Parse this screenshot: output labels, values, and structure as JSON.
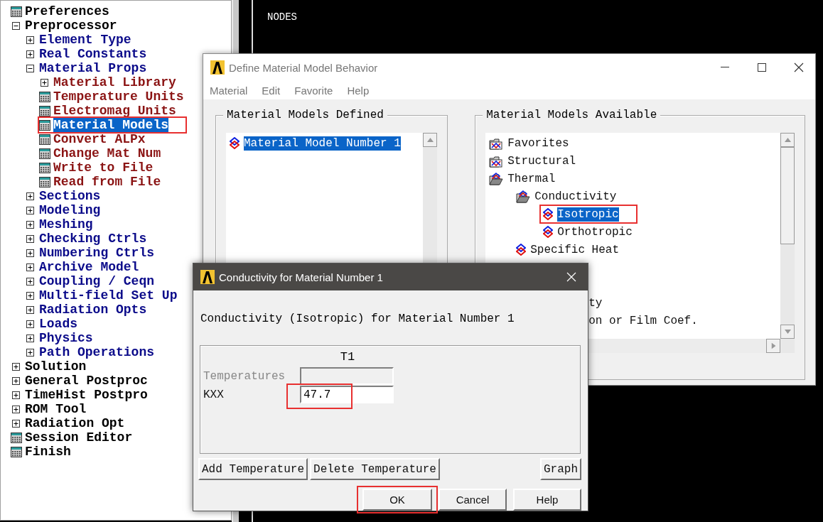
{
  "sidebar": {
    "items": [
      {
        "label": "Preferences",
        "kind": "action",
        "selected": false
      },
      {
        "label": "Preprocessor",
        "kind": "branch",
        "expanded": true,
        "selected": false,
        "children": [
          {
            "label": "Element Type",
            "kind": "branch",
            "expanded": false,
            "selected": false
          },
          {
            "label": "Real Constants",
            "kind": "branch",
            "expanded": false,
            "selected": false
          },
          {
            "label": "Material Props",
            "kind": "branch",
            "expanded": true,
            "selected": false,
            "children": [
              {
                "label": "Material Library",
                "kind": "branch",
                "expanded": false,
                "selected": false
              },
              {
                "label": "Temperature Units",
                "kind": "action",
                "selected": false
              },
              {
                "label": "Electromag Units",
                "kind": "action",
                "selected": false
              },
              {
                "label": "Material Models",
                "kind": "action",
                "selected": true,
                "annotated": true
              },
              {
                "label": "Convert ALPx",
                "kind": "action",
                "selected": false
              },
              {
                "label": "Change Mat Num",
                "kind": "action",
                "selected": false
              },
              {
                "label": "Write to File",
                "kind": "action",
                "selected": false
              },
              {
                "label": "Read from File",
                "kind": "action",
                "selected": false
              }
            ]
          },
          {
            "label": "Sections",
            "kind": "branch",
            "expanded": false,
            "selected": false
          },
          {
            "label": "Modeling",
            "kind": "branch",
            "expanded": false,
            "selected": false
          },
          {
            "label": "Meshing",
            "kind": "branch",
            "expanded": false,
            "selected": false
          },
          {
            "label": "Checking Ctrls",
            "kind": "branch",
            "expanded": false,
            "selected": false
          },
          {
            "label": "Numbering Ctrls",
            "kind": "branch",
            "expanded": false,
            "selected": false
          },
          {
            "label": "Archive Model",
            "kind": "branch",
            "expanded": false,
            "selected": false
          },
          {
            "label": "Coupling / Ceqn",
            "kind": "branch",
            "expanded": false,
            "selected": false
          },
          {
            "label": "Multi-field Set Up",
            "kind": "branch",
            "expanded": false,
            "selected": false
          },
          {
            "label": "Radiation Opts",
            "kind": "branch",
            "expanded": false,
            "selected": false
          },
          {
            "label": "Loads",
            "kind": "branch",
            "expanded": false,
            "selected": false
          },
          {
            "label": "Physics",
            "kind": "branch",
            "expanded": false,
            "selected": false
          },
          {
            "label": "Path Operations",
            "kind": "branch",
            "expanded": false,
            "selected": false
          }
        ]
      },
      {
        "label": "Solution",
        "kind": "branch",
        "expanded": false,
        "selected": false
      },
      {
        "label": "General Postproc",
        "kind": "branch",
        "expanded": false,
        "selected": false
      },
      {
        "label": "TimeHist Postpro",
        "kind": "branch",
        "expanded": false,
        "selected": false
      },
      {
        "label": "ROM Tool",
        "kind": "branch",
        "expanded": false,
        "selected": false
      },
      {
        "label": "Radiation Opt",
        "kind": "branch",
        "expanded": false,
        "selected": false
      },
      {
        "label": "Session Editor",
        "kind": "action",
        "selected": false
      },
      {
        "label": "Finish",
        "kind": "action",
        "selected": false
      }
    ]
  },
  "graphics": {
    "label": "NODES"
  },
  "material_window": {
    "title": "Define Material Model Behavior",
    "menu": [
      "Material",
      "Edit",
      "Favorite",
      "Help"
    ],
    "defined": {
      "title": "Material Models Defined",
      "items": [
        {
          "label": "Material Model Number 1",
          "selected": true
        }
      ]
    },
    "available": {
      "title": "Material Models Available",
      "items": [
        {
          "label": "Favorites",
          "kind": "folder",
          "expanded": false,
          "selected": false
        },
        {
          "label": "Structural",
          "kind": "folder",
          "expanded": false,
          "selected": false
        },
        {
          "label": "Thermal",
          "kind": "folder",
          "expanded": true,
          "selected": false,
          "children": [
            {
              "label": "Conductivity",
              "kind": "folder",
              "expanded": true,
              "selected": false,
              "children": [
                {
                  "label": "Isotropic",
                  "kind": "model",
                  "selected": true,
                  "annotated": true
                },
                {
                  "label": "Orthotropic",
                  "kind": "model",
                  "selected": false
                }
              ]
            },
            {
              "label": "Specific Heat",
              "kind": "model",
              "selected": false
            }
          ]
        }
      ],
      "partly_covered": [
        "ty",
        "on or Film Coef."
      ]
    }
  },
  "dialog": {
    "title": "Conductivity for Material Number 1",
    "heading": "Conductivity (Isotropic) for Material Number 1",
    "column": "T1",
    "rows": [
      {
        "label": "Temperatures",
        "disabled": true
      },
      {
        "label": "KXX",
        "value": "47.7",
        "disabled": false,
        "annotated": true
      }
    ],
    "table_buttons": [
      "Add Temperature",
      "Delete Temperature"
    ],
    "graph_button": "Graph",
    "actions": [
      {
        "label": "OK",
        "annotated": true
      },
      {
        "label": "Cancel"
      },
      {
        "label": "Help"
      }
    ]
  }
}
